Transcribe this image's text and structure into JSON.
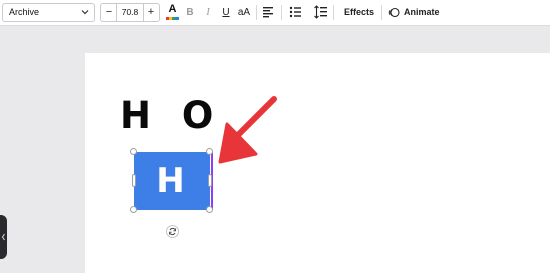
{
  "toolbar": {
    "font_family": "Archive",
    "font_size": "70.8",
    "decrease_label": "−",
    "increase_label": "+",
    "text_color_glyph": "A",
    "bold_glyph": "B",
    "italic_glyph": "I",
    "underline_glyph": "U",
    "case_glyph": "aA",
    "effects_label": "Effects",
    "animate_label": "Animate"
  },
  "canvas": {
    "heading_text": "H O",
    "selected_text": "H O",
    "selection_fill": "#3d7fe6",
    "arrow_color": "#e8353a"
  }
}
